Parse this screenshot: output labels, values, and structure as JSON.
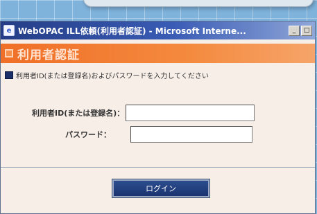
{
  "window": {
    "title": "WebOPAC ILL依頼(利用者認証) - Microsoft Interne...",
    "app_icon": "ie-icon",
    "controls": {
      "minimize": "_",
      "maximize": "□"
    }
  },
  "header": {
    "title": "利用者認証",
    "color": "#f06f28"
  },
  "instruction": {
    "text": "利用者ID(または登録名)およびパスワードを入力してください"
  },
  "form": {
    "user_id_label": "利用者ID(または登録名)：",
    "user_id_value": "",
    "password_label": "パスワード：",
    "password_value": ""
  },
  "login_button": {
    "label": "ログイン",
    "color": "#1c3470"
  }
}
